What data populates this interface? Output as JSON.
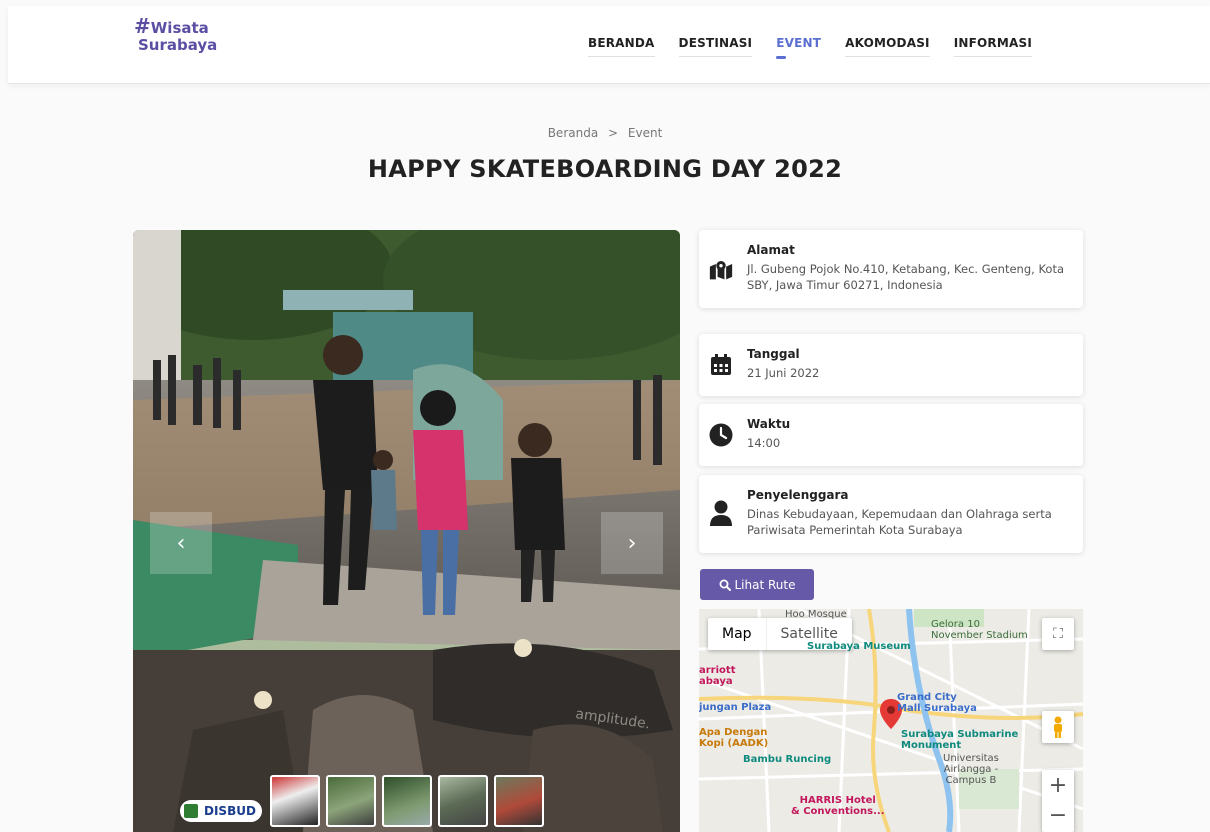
{
  "logo": {
    "hash": "#",
    "line1": "Wisata",
    "line2": "Surabaya"
  },
  "nav": {
    "items": [
      "BERANDA",
      "DESTINASI",
      "EVENT",
      "AKOMODASI",
      "INFORMASI"
    ],
    "active": "EVENT"
  },
  "breadcrumb": {
    "home": "Beranda",
    "separator": ">",
    "current": "Event"
  },
  "page_title": "HAPPY SKATEBOARDING DAY 2022",
  "slider": {
    "prev_icon": "chevron-left-icon",
    "next_icon": "chevron-right-icon",
    "badge_text": "DISBUD",
    "thumbnail_count": 5,
    "photo_text": "amplitude."
  },
  "details": {
    "address": {
      "label": "Alamat",
      "value": "Jl. Gubeng Pojok No.410, Ketabang, Kec. Genteng, Kota SBY, Jawa Timur 60271, Indonesia",
      "icon": "map-location-icon"
    },
    "date": {
      "label": "Tanggal",
      "value": "21 Juni 2022",
      "icon": "calendar-icon"
    },
    "time": {
      "label": "Waktu",
      "value": "14:00",
      "icon": "clock-icon"
    },
    "organizer": {
      "label": "Penyelenggara",
      "value": "Dinas Kebudayaan, Kepemudaan dan Olahraga serta Pariwisata Pemerintah Kota Surabaya",
      "icon": "user-icon"
    }
  },
  "route_button": {
    "label": "Lihat Rute",
    "icon": "search-icon"
  },
  "map": {
    "type_map": "Map",
    "type_satellite": "Satellite",
    "zoom_in": "+",
    "zoom_out": "−",
    "labels": {
      "hoo": "Hoo Mosque",
      "gelora": "Gelora 10\nNovember Stadium",
      "museum": "Surabaya Museum",
      "marriott": "arriott\nabaya",
      "grand_city": "Grand City\nMall Surabaya",
      "tunjungan": "jungan Plaza",
      "apa_dengan": "Apa Dengan\nKopi (AADK)",
      "submarine": "Surabaya Submarine\nMonument",
      "bambu": "Bambu Runcing",
      "unair": "Universitas\nAirlangga -\nCampus B",
      "harris": "HARRIS Hotel\n& Conventions..."
    }
  },
  "colors": {
    "brand": "#5b4fa3",
    "accent": "#5b6fd0",
    "button": "#6659a8"
  }
}
